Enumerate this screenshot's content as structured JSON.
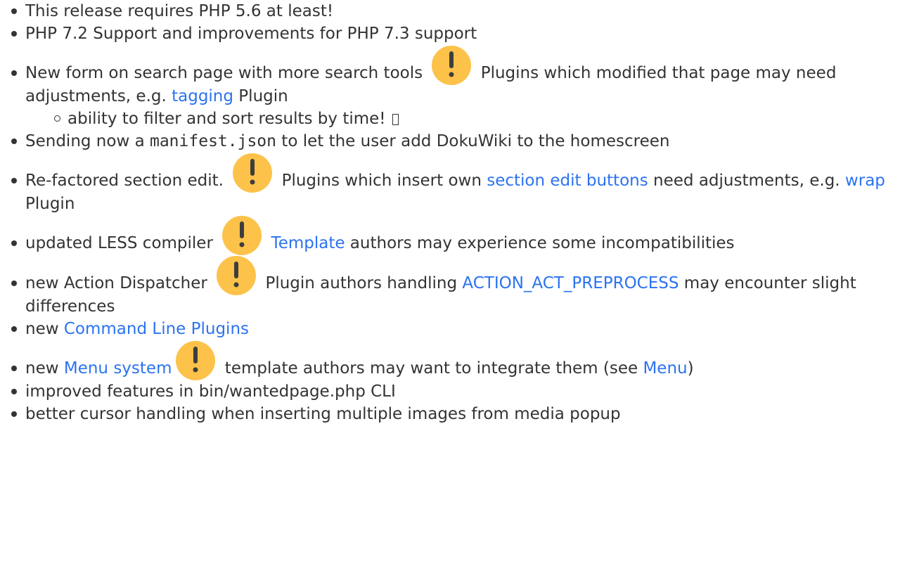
{
  "colors": {
    "text": "#333333",
    "link": "#2b73f0",
    "warning_icon_fill": "#fcc24a",
    "warning_icon_mark": "#3d3d3d"
  },
  "icons": {
    "warning": "exclamation-warning-icon",
    "missing_glyph": "missing-glyph-box"
  },
  "items": {
    "i1": {
      "text": "This release requires PHP 5.6 at least!"
    },
    "i2": {
      "text": "PHP 7.2 Support and improvements for PHP 7.3 support"
    },
    "i3": {
      "before": "New form on search page with more search tools ",
      "after_icon": " Plugins which modified that page may need adjustments, e.g. ",
      "link": "tagging",
      "after_link": " Plugin",
      "sub": {
        "text": "ability to filter and sort results by time! "
      }
    },
    "i4": {
      "before": "Sending now a ",
      "code": "manifest.json",
      "after": " to let the user add DokuWiki to the homescreen"
    },
    "i5": {
      "before": "Re-factored section edit. ",
      "after_icon": " Plugins which insert own ",
      "link1": "section edit buttons",
      "middle": " need adjustments, e.g. ",
      "link2": "wrap",
      "after": " Plugin"
    },
    "i6": {
      "before": "updated LESS compiler ",
      "link": "Template",
      "after": " authors may experience some incompatibilities"
    },
    "i7": {
      "before": "new Action Dispatcher ",
      "after_icon": " Plugin authors handling ",
      "link": "ACTION_ACT_PREPROCESS",
      "after": " may encounter slight differences"
    },
    "i8": {
      "before": "new ",
      "link": "Command Line Plugins"
    },
    "i9": {
      "before": "new ",
      "link1": "Menu system",
      "after_icon": " template authors may want to integrate them (see ",
      "link2": "Menu",
      "after": ")"
    },
    "i10": {
      "text": "improved features in bin/wantedpage.php CLI"
    },
    "i11": {
      "text": "better cursor handling when inserting multiple images from media popup"
    }
  }
}
